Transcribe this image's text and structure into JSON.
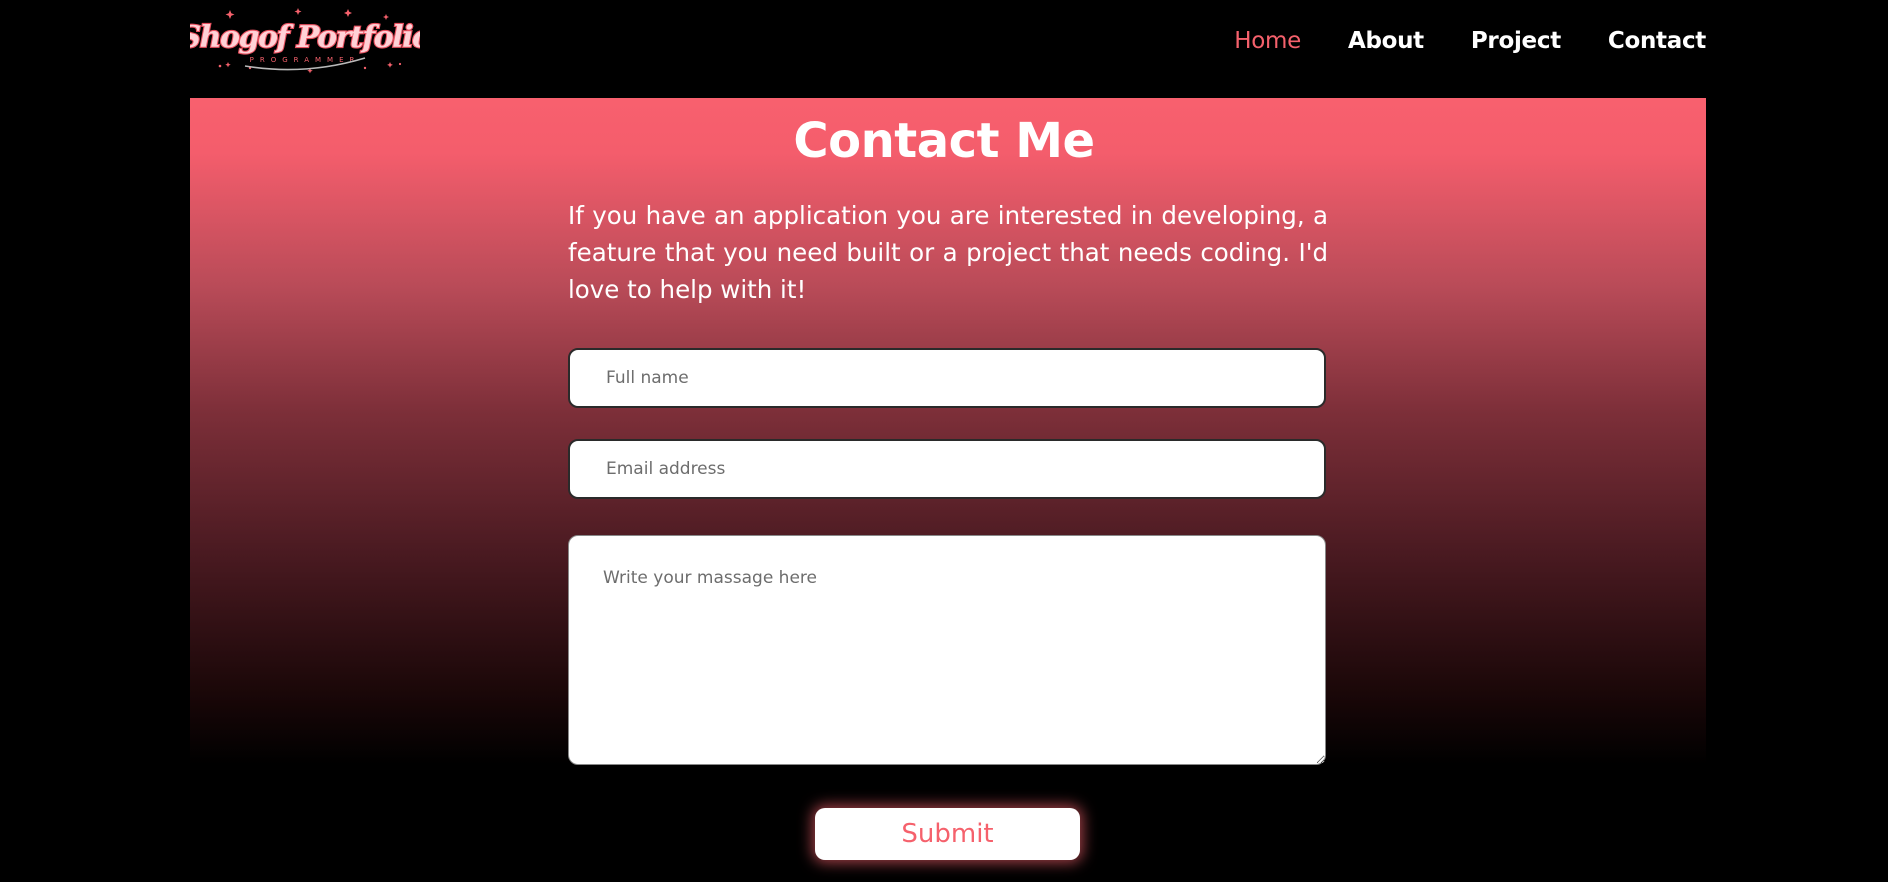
{
  "header": {
    "logo": {
      "text": "Shogof Portfolio",
      "subtext": "PROGRAMMER"
    },
    "nav": [
      {
        "label": "Home",
        "active": true
      },
      {
        "label": "About",
        "active": false
      },
      {
        "label": "Project",
        "active": false
      },
      {
        "label": "Contact",
        "active": false
      }
    ]
  },
  "contact": {
    "title": "Contact Me",
    "intro": "If you have an application you are interested in developing, a feature that you need built or a project that needs coding. I'd love to help with it!",
    "name_placeholder": "Full name",
    "email_placeholder": "Email address",
    "message_placeholder": "Write your massage here",
    "submit_label": "Submit"
  },
  "colors": {
    "accent": "#f5616c",
    "background": "#000000",
    "text": "#ffffff"
  }
}
